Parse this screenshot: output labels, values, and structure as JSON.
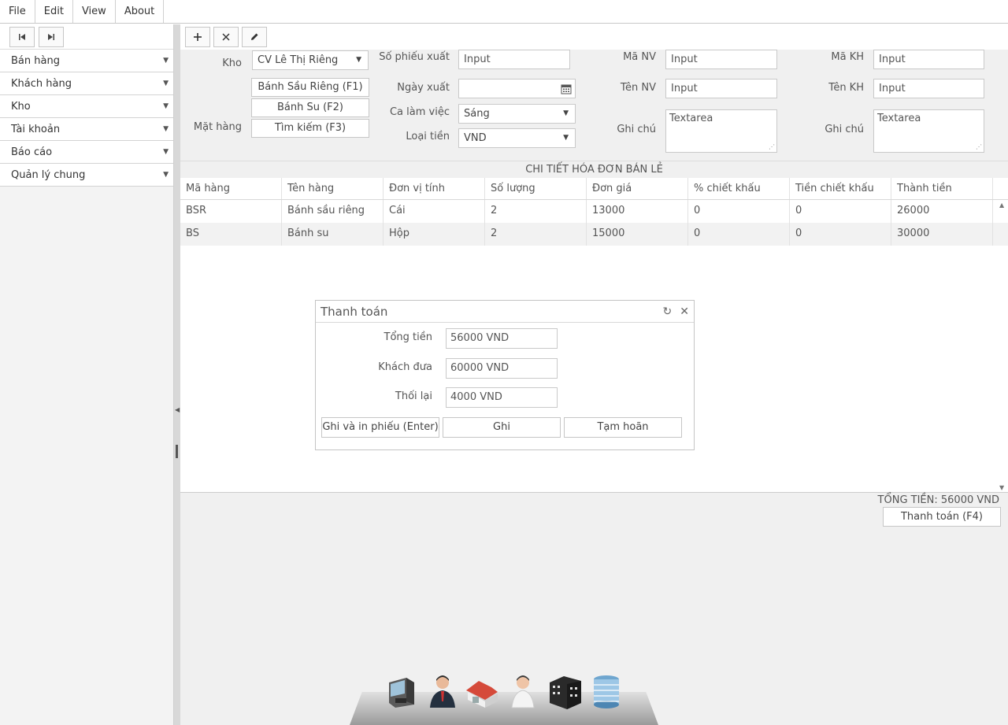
{
  "menu": [
    "File",
    "Edit",
    "View",
    "About"
  ],
  "sidebar": {
    "items": [
      {
        "label": "Bán hàng"
      },
      {
        "label": "Khách hàng"
      },
      {
        "label": "Kho"
      },
      {
        "label": "Tài khoản"
      },
      {
        "label": "Báo cáo"
      },
      {
        "label": "Quản lý chung"
      }
    ]
  },
  "form": {
    "kho_label": "Kho",
    "kho_value": "CV Lê Thị Riêng",
    "mathang_label": "Mặt hàng",
    "btn_f1": "Bánh Sầu Riêng (F1)",
    "btn_f2": "Bánh Su (F2)",
    "btn_f3": "Tìm kiếm (F3)",
    "sophieu_label": "Số phiếu xuất",
    "sophieu_placeholder": "Input",
    "ngayxuat_label": "Ngày xuất",
    "ca_label": "Ca làm việc",
    "ca_value": "Sáng",
    "loaitien_label": "Loại tiền",
    "loaitien_value": "VND",
    "manv_label": "Mã NV",
    "manv_placeholder": "Input",
    "tennv_label": "Tên NV",
    "tennv_placeholder": "Input",
    "ghichu1_label": "Ghi chú",
    "ghichu1_placeholder": "Textarea",
    "makh_label": "Mã KH",
    "makh_placeholder": "Input",
    "tenkh_label": "Tên KH",
    "tenkh_placeholder": "Input",
    "ghichu2_label": "Ghi chú",
    "ghichu2_placeholder": "Textarea"
  },
  "table": {
    "title": "CHI TIẾT HÓA ĐƠN BÁN LẺ",
    "columns": [
      "Mã hàng",
      "Tên hàng",
      "Đơn vị tính",
      "Số lượng",
      "Đơn giá",
      "% chiết khấu",
      "Tiền chiết khấu",
      "Thành tiền"
    ],
    "rows": [
      [
        "BSR",
        "Bánh sầu riêng",
        "Cái",
        "2",
        "13000",
        "0",
        "0",
        "26000"
      ],
      [
        "BS",
        "Bánh su",
        "Hộp",
        "2",
        "15000",
        "0",
        "0",
        "30000"
      ]
    ]
  },
  "footer": {
    "total": "TỔNG TIỀN: 56000 VND",
    "pay_button": "Thanh toán (F4)"
  },
  "dialog": {
    "title": "Thanh toán",
    "tongtien_label": "Tổng tiền",
    "tongtien_value": "56000 VND",
    "khachdua_label": "Khách đưa",
    "khachdua_value": "60000 VND",
    "thoilai_label": "Thối lại",
    "thoilai_value": "4000 VND",
    "btn_save_print": "Ghi và in phiếu (Enter)",
    "btn_save": "Ghi",
    "btn_postpone": "Tạm hoãn"
  },
  "icons": {
    "dock": [
      "cash-register-icon",
      "businessman-icon",
      "warehouse-icon",
      "employee-icon",
      "office-building-icon",
      "glass-building-icon"
    ]
  }
}
